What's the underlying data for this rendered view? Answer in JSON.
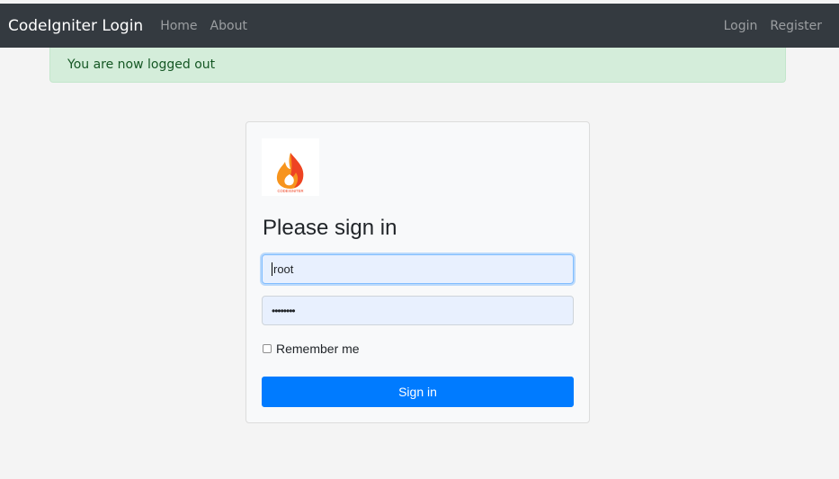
{
  "navbar": {
    "brand": "CodeIgniter Login",
    "left_links": [
      "Home",
      "About"
    ],
    "right_links": [
      "Login",
      "Register"
    ]
  },
  "alert": {
    "message": "You are now logged out"
  },
  "login_card": {
    "logo_text": "CODEIGNITER",
    "heading": "Please sign in",
    "username_value": "root",
    "password_masked": "••••••••",
    "remember_label": "Remember me",
    "remember_checked": false,
    "submit_label": "Sign in"
  },
  "colors": {
    "navbar_bg": "#343a40",
    "alert_bg": "#d4edda",
    "primary": "#007bff",
    "input_bg": "#e8f0fe"
  }
}
